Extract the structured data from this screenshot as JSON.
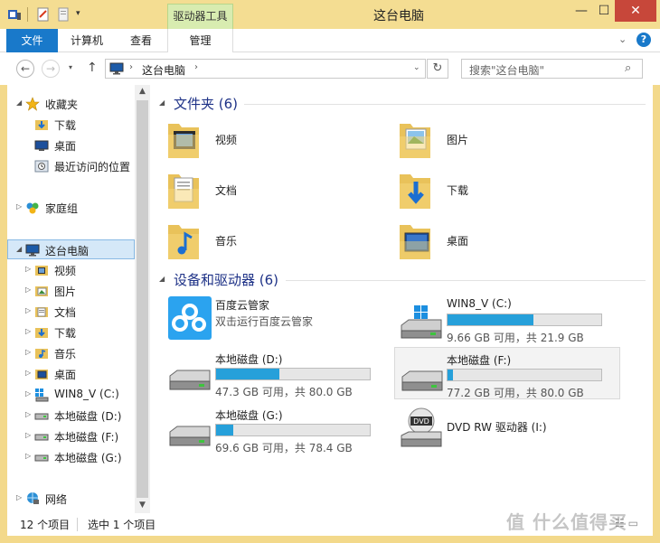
{
  "window": {
    "title": "这台电脑",
    "tool_tab": "驱动器工具",
    "controls": {
      "minimize": "—",
      "maximize": "☐",
      "close": "✕"
    }
  },
  "quick_access": {
    "dropdown": "▾"
  },
  "ribbon": {
    "tabs": [
      {
        "label": "文件"
      },
      {
        "label": "计算机"
      },
      {
        "label": "查看"
      },
      {
        "label": "管理"
      }
    ],
    "expand": "⌄",
    "help": "?"
  },
  "address_bar": {
    "back": "←",
    "forward": "→",
    "recent": "▾",
    "up": "↑",
    "chevron": "›",
    "path": "这台电脑",
    "dropdown": "⌄",
    "refresh": "↻",
    "search_placeholder": "搜索\"这台电脑\"",
    "search_icon": "⌕"
  },
  "nav_pane": {
    "items": [
      {
        "label": "收藏夹",
        "icon": "star-icon",
        "arrow": "◢"
      },
      {
        "label": "下载",
        "icon": "downloads-icon"
      },
      {
        "label": "桌面",
        "icon": "desktop-icon"
      },
      {
        "label": "最近访问的位置",
        "icon": "recent-places-icon"
      },
      {
        "label": "家庭组",
        "icon": "homegroup-icon",
        "arrow": "▷"
      },
      {
        "label": "这台电脑",
        "icon": "computer-icon",
        "arrow": "◢"
      },
      {
        "label": "视频",
        "icon": "videos-icon",
        "arrow": "▷"
      },
      {
        "label": "图片",
        "icon": "pictures-icon",
        "arrow": "▷"
      },
      {
        "label": "文档",
        "icon": "documents-icon",
        "arrow": "▷"
      },
      {
        "label": "下载",
        "icon": "downloads-icon",
        "arrow": "▷"
      },
      {
        "label": "音乐",
        "icon": "music-icon",
        "arrow": "▷"
      },
      {
        "label": "桌面",
        "icon": "desktop-icon",
        "arrow": "▷"
      },
      {
        "label": "WIN8_V (C:)",
        "icon": "system-drive-icon",
        "arrow": "▷"
      },
      {
        "label": "本地磁盘 (D:)",
        "icon": "drive-icon",
        "arrow": "▷"
      },
      {
        "label": "本地磁盘 (F:)",
        "icon": "drive-icon",
        "arrow": "▷"
      },
      {
        "label": "本地磁盘 (G:)",
        "icon": "drive-icon",
        "arrow": "▷"
      },
      {
        "label": "网络",
        "icon": "network-icon",
        "arrow": "▷"
      }
    ],
    "scroll_up": "▲",
    "scroll_down": "▼"
  },
  "folders_group": {
    "title": "文件夹 (6)",
    "arrow": "◢",
    "items": [
      {
        "label": "视频",
        "icon": "videos-folder-icon"
      },
      {
        "label": "图片",
        "icon": "pictures-folder-icon"
      },
      {
        "label": "文档",
        "icon": "documents-folder-icon"
      },
      {
        "label": "下载",
        "icon": "downloads-folder-icon"
      },
      {
        "label": "音乐",
        "icon": "music-folder-icon"
      },
      {
        "label": "桌面",
        "icon": "desktop-folder-icon"
      }
    ]
  },
  "devices_group": {
    "title": "设备和驱动器 (6)",
    "arrow": "◢",
    "items": [
      {
        "name": "百度云管家",
        "sub": "双击运行百度云管家",
        "icon": "baidu-cloud-icon"
      },
      {
        "name": "WIN8_V (C:)",
        "free": "9.66 GB 可用，共 21.9 GB",
        "used_fraction": 0.56,
        "icon": "system-drive-icon"
      },
      {
        "name": "本地磁盘 (D:)",
        "free": "47.3 GB 可用，共 80.0 GB",
        "used_fraction": 0.41,
        "icon": "drive-icon"
      },
      {
        "name": "本地磁盘 (F:)",
        "free": "77.2 GB 可用，共 80.0 GB",
        "used_fraction": 0.035,
        "icon": "drive-icon",
        "selected": true
      },
      {
        "name": "本地磁盘 (G:)",
        "free": "69.6 GB 可用，共 78.4 GB",
        "used_fraction": 0.11,
        "icon": "drive-icon"
      },
      {
        "name": "DVD RW 驱动器 (I:)",
        "icon": "dvd-drive-icon"
      }
    ]
  },
  "status_bar": {
    "count": "12 个项目",
    "selected": "选中 1 个项目",
    "view_icons": "☷ ▭"
  },
  "watermark": "值 什么值得买",
  "colors": {
    "accent": "#1979ca",
    "title_bar": "#f4dd92",
    "group_heading": "#1e3287",
    "progress_fill": "#26a0da",
    "close_button": "#c7473a"
  }
}
